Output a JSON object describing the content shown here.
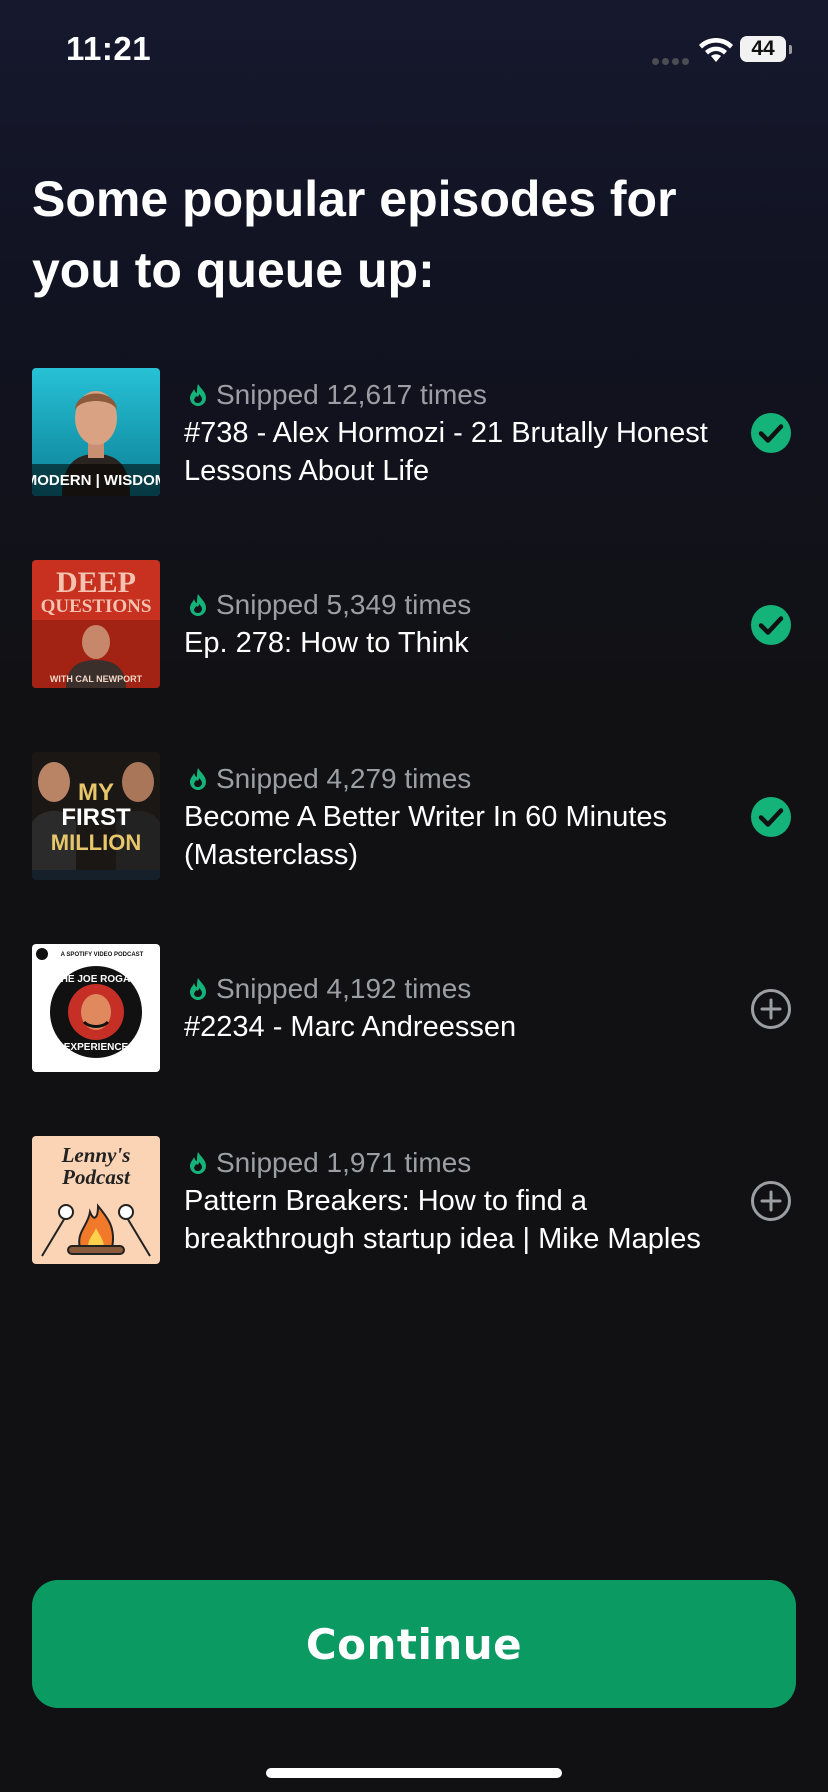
{
  "status_bar": {
    "time": "11:21",
    "battery": "44"
  },
  "heading": "Some popular episodes for you to queue up:",
  "episodes": [
    {
      "podcast": "Modern Wisdom",
      "art_text": "MODERN | WISDOM",
      "snips": "Snipped 12,617 times",
      "title": "#738 - Alex Hormozi - 21 Brutally Honest Lessons About Life",
      "queued": true
    },
    {
      "podcast": "Deep Questions",
      "art_text": "DEEP QUESTIONS",
      "art_subtext": "WITH CAL NEWPORT",
      "snips": "Snipped 5,349 times",
      "title": "Ep. 278: How to Think",
      "queued": true
    },
    {
      "podcast": "My First Million",
      "art_text": "MY FIRST MILLION",
      "snips": "Snipped 4,279 times",
      "title": "Become A Better Writer In 60 Minutes (Masterclass)",
      "queued": true
    },
    {
      "podcast": "The Joe Rogan Experience",
      "art_text": "THE JOE ROGAN EXPERIENCE",
      "art_subtext": "A SPOTIFY VIDEO PODCAST",
      "snips": "Snipped 4,192 times",
      "title": "#2234 - Marc Andreessen",
      "queued": false
    },
    {
      "podcast": "Lenny's Podcast",
      "art_text": "Lenny's Podcast",
      "snips": "Snipped 1,971 times",
      "title": "Pattern Breakers: How to find a breakthrough startup idea | Mike Maples",
      "queued": false
    }
  ],
  "icons": {
    "flame": "flame-icon",
    "queued": "check-circle-icon",
    "add": "plus-circle-icon"
  },
  "colors": {
    "accent": "#0c9a63",
    "check": "#14b37a",
    "background": "#111114"
  },
  "continue_label": "Continue"
}
